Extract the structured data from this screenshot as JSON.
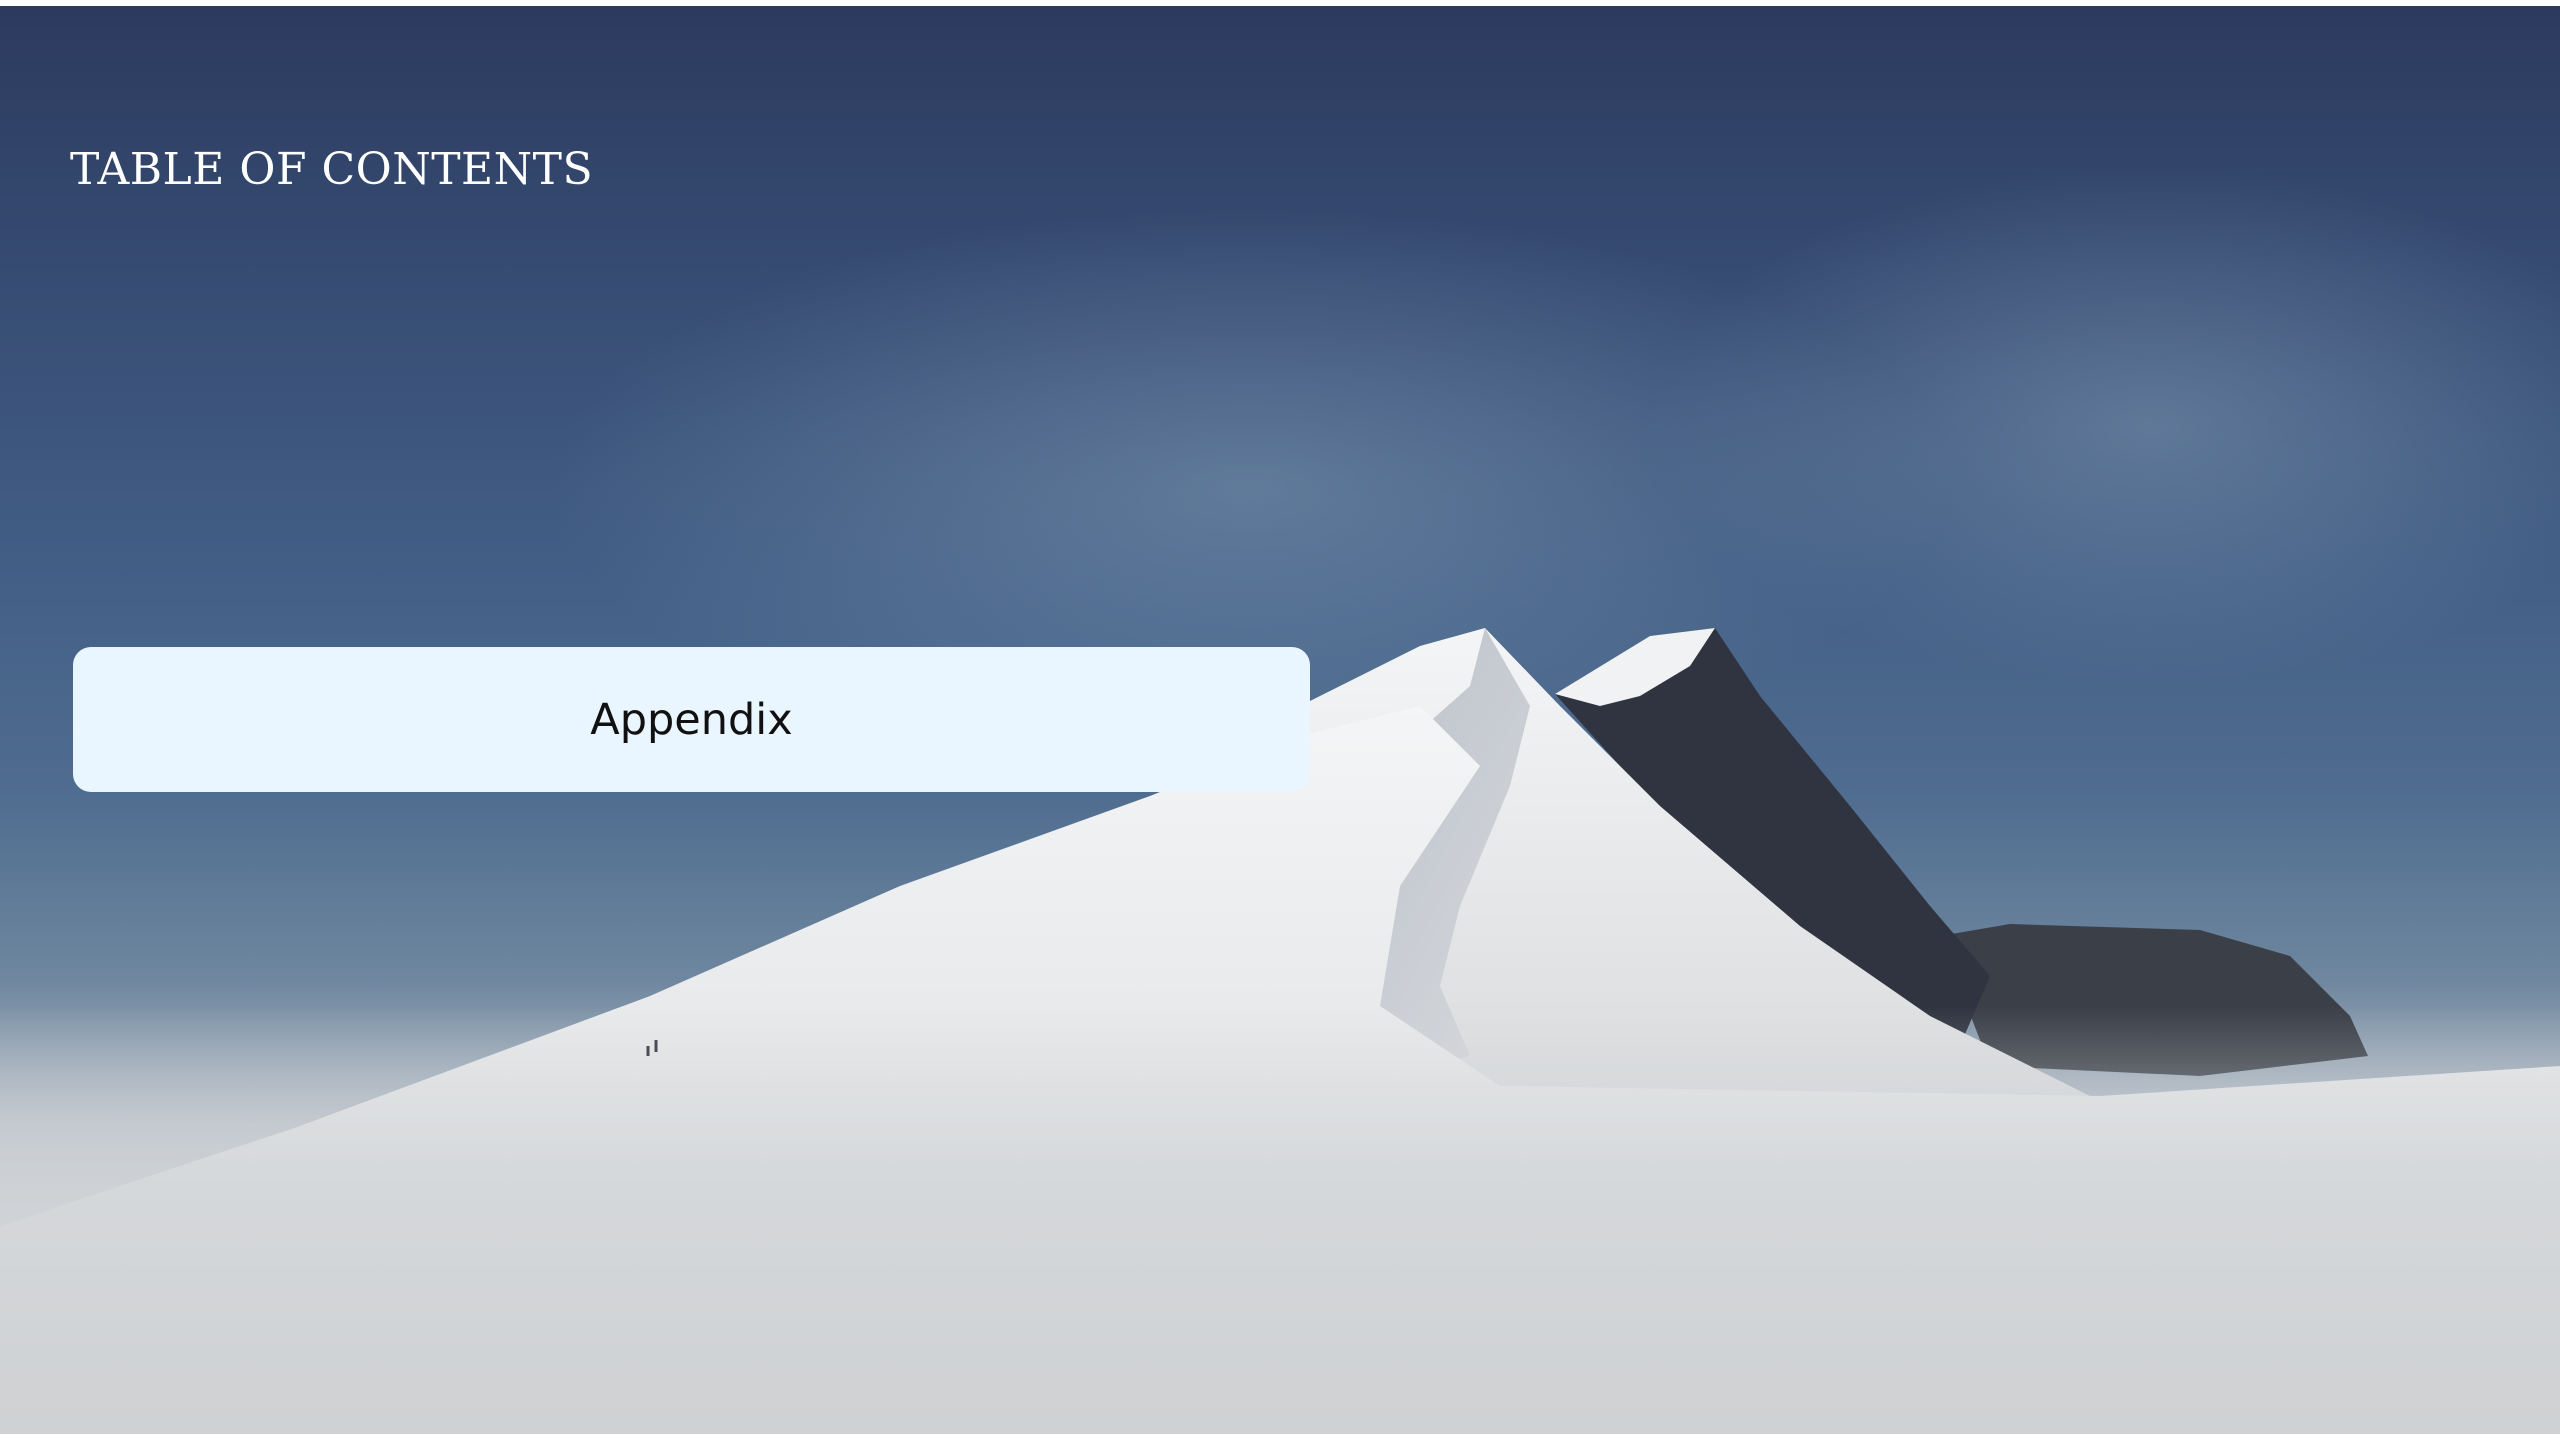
{
  "slide": {
    "title": "TABLE OF CONTENTS",
    "items": [
      {
        "label": "Appendix"
      }
    ]
  },
  "background": {
    "description_icon": "snowy-mountain-photo",
    "sky_color": "#364b72",
    "snow_color": "#d9dbdd"
  },
  "colors": {
    "card_background": "#eaf6ff",
    "title_text": "#ffffff",
    "card_text": "#111111"
  }
}
